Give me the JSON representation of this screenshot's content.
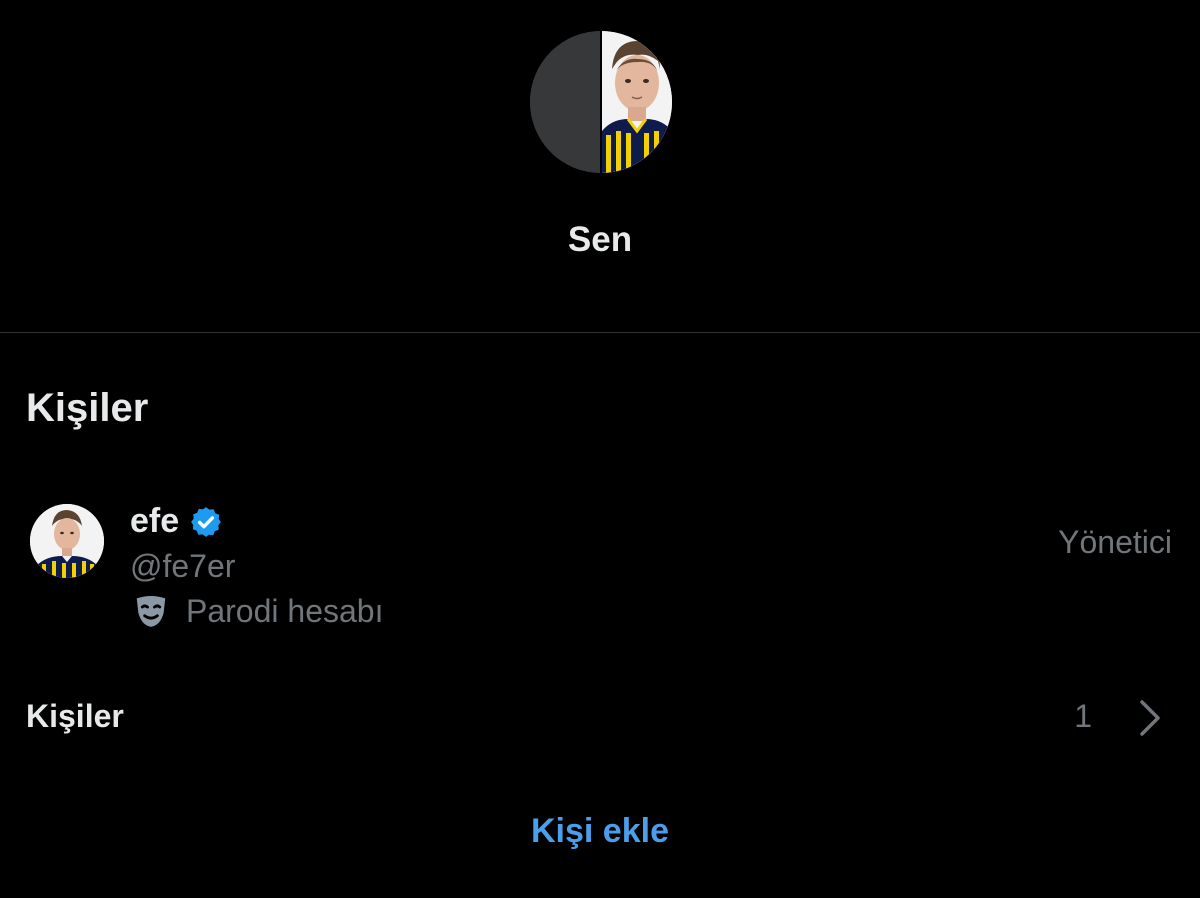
{
  "group": {
    "name": "Sen",
    "avatar_icon": "group-avatar-split"
  },
  "people_section": {
    "title": "Kişiler"
  },
  "members": [
    {
      "name": "efe",
      "verified": true,
      "handle": "@fe7er",
      "label_icon": "parody-mask-icon",
      "label": "Parodi hesabı",
      "role": "Yönetici"
    }
  ],
  "people_row": {
    "label": "Kişiler",
    "count": "1",
    "icon": "chevron-right-icon"
  },
  "actions": {
    "add_person": "Kişi ekle"
  },
  "colors": {
    "background": "#000000",
    "primary_text": "#e7e9ea",
    "secondary_text": "#71767b",
    "accent": "#4a9eeb",
    "verified": "#1d9bf0",
    "divider": "#2f3336"
  }
}
